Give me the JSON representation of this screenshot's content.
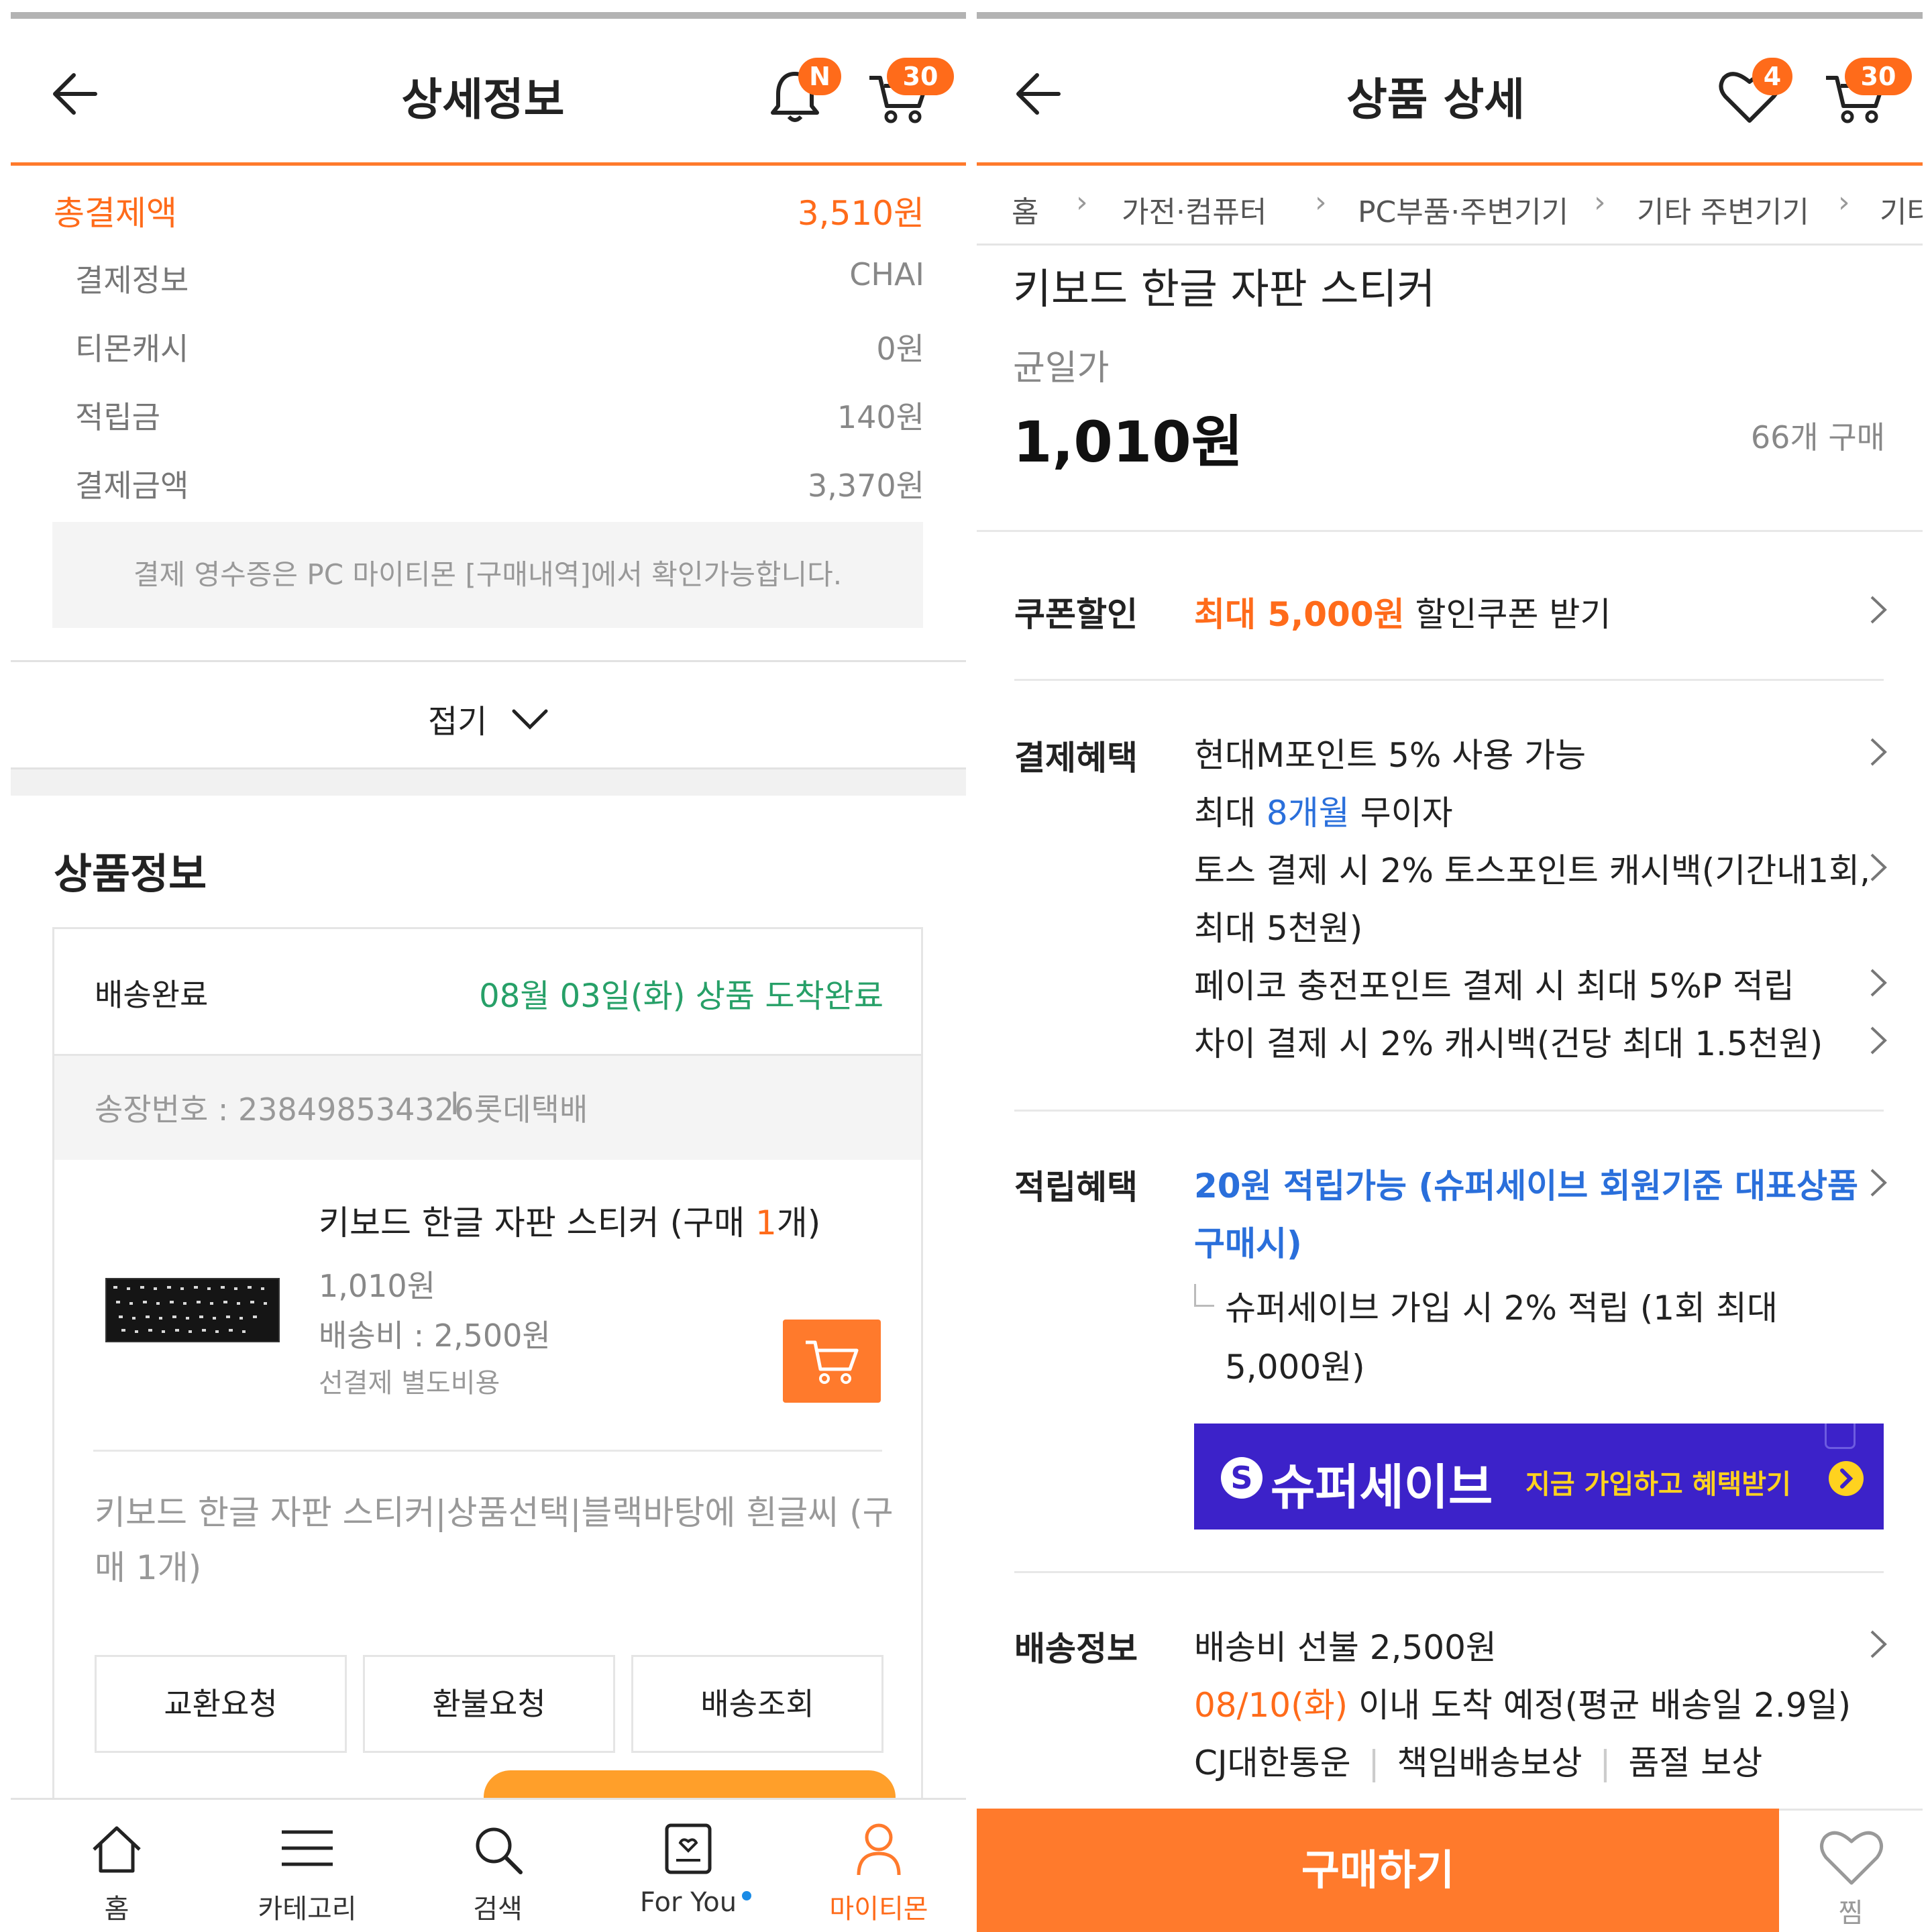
{
  "left": {
    "header": {
      "title": "상세정보",
      "bell_badge": "N",
      "cart_badge": "30"
    },
    "payment": {
      "total_label": "총결제액",
      "total_value": "3,510원",
      "rows": [
        {
          "label": "결제정보",
          "value": "CHAI"
        },
        {
          "label": "티몬캐시",
          "value": "0원"
        },
        {
          "label": "적립금",
          "value": "140원"
        },
        {
          "label": "결제금액",
          "value": "3,370원"
        }
      ],
      "notice": "결제 영수증은 PC 마이티몬 [구매내역]에서 확인가능합니다.",
      "fold_label": "접기"
    },
    "product_section": {
      "title": "상품정보",
      "status_label": "배송완료",
      "status_value": "08월 03일(화) 상품 도착완료",
      "tracking_label": "송장번호 : 238498534326",
      "tracking_sep": "I",
      "courier": "롯데택배",
      "item_name_prefix": "키보드 한글 자판 스티커 (구매 ",
      "item_qty": "1",
      "item_name_suffix": "개)",
      "item_price": "1,010원",
      "shipping_fee": "배송비 : 2,500원",
      "prepay_note": "선결제 별도비용",
      "option_text_line1": "키보드 한글 자판 스티커|상품선택|블랙바탕에 흰글씨 (구",
      "option_text_line2": "매 1개)",
      "buttons": [
        "교환요청",
        "환불요청",
        "배송조회"
      ]
    },
    "bottom_nav": [
      {
        "label": "홈",
        "icon": "home-icon"
      },
      {
        "label": "카테고리",
        "icon": "menu-icon"
      },
      {
        "label": "검색",
        "icon": "search-icon"
      },
      {
        "label": "For You",
        "icon": "foryou-icon"
      },
      {
        "label": "마이티몬",
        "icon": "person-icon"
      }
    ],
    "colors": {
      "accent": "#ff6b1a",
      "green": "#27a068"
    }
  },
  "right": {
    "header": {
      "title": "상품 상세",
      "heart_badge": "4",
      "cart_badge": "30"
    },
    "breadcrumb": [
      "홈",
      "가전·컴퓨터",
      "PC부품·주변기기",
      "기타 주변기기",
      "기타"
    ],
    "product": {
      "name": "키보드 한글 자판 스티커",
      "price_label": "균일가",
      "price": "1,010원",
      "purchase_count": "66개 구매"
    },
    "coupon": {
      "label": "쿠폰할인",
      "highlight_prefix": "최대 ",
      "highlight_amount": "5,000원",
      "suffix": " 할인쿠폰 받기"
    },
    "payment_benefit": {
      "label": "결제혜택",
      "line1": "현대M포인트 5% 사용 가능",
      "line2_prefix": "최대 ",
      "line2_highlight": "8개월",
      "line2_suffix": " 무이자",
      "line3": "토스 결제 시 2% 토스포인트 캐시백(기간내1회,",
      "line4": "최대 5천원)",
      "line5": "페이코 충전포인트 결제 시 최대 5%P 적립",
      "line6": "차이 결제 시 2% 캐시백(건당 최대 1.5천원)"
    },
    "points_benefit": {
      "label": "적립혜택",
      "line1": "20원 적립가능 (슈퍼세이브 회원기준 대표상품",
      "line2": "구매시)",
      "sub_line1": "슈퍼세이브 가입 시 2% 적립 (1회 최대",
      "sub_line2": "5,000원)",
      "banner_brand": "슈퍼세이브",
      "banner_cta": "지금 가입하고 혜택받기"
    },
    "shipping": {
      "label": "배송정보",
      "line1": "배송비 선불 2,500원",
      "line2_date": "08/10(화)",
      "line2_rest": " 이내 도착 예정(평균 배송일 2.9일)",
      "line3_a": "CJ대한통운",
      "line3_b": "책임배송보상",
      "line3_c": "품절 보상"
    },
    "buy_button": "구매하기",
    "wish_label": "찜",
    "colors": {
      "accent": "#ff7a2c",
      "banner": "#3c22c9",
      "blue": "#2a6fdb"
    }
  }
}
